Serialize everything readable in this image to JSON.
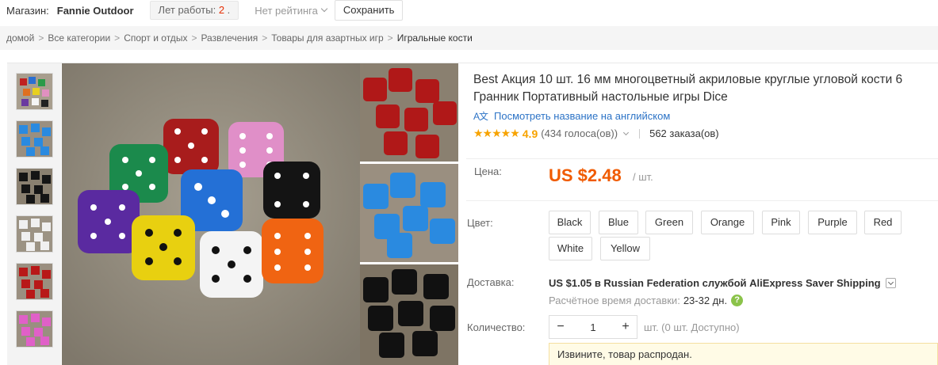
{
  "store": {
    "label": "Магазин:",
    "name": "Fannie Outdoor",
    "years_label": "Лет работы:",
    "years_value": "2",
    "rating": "Нет рейтинга",
    "save": "Сохранить"
  },
  "breadcrumb": [
    "домой",
    "Все категории",
    "Спорт и отдых",
    "Развлечения",
    "Товары для азартных игр",
    "Игральные кости"
  ],
  "breadcrumb_sep": ">",
  "product": {
    "title": "Best Акция 10 шт. 16 мм многоцветный акриловые круглые угловой кости 6 Гранник Портативный настольные игры Dice",
    "translate_icon": "A文",
    "translate_label": "Посмотреть название на английском",
    "stars": "★★★★★",
    "rating": "4.9",
    "votes": "(434 голоса(ов))",
    "orders": "562 заказа(ов)",
    "price_label": "Цена:",
    "price": "US $2.48",
    "price_unit": "/ шт.",
    "color_label": "Цвет:",
    "colors": [
      "Black",
      "Blue",
      "Green",
      "Orange",
      "Pink",
      "Purple",
      "Red",
      "White",
      "Yellow"
    ],
    "shipping_label": "Доставка:",
    "shipping": "US $1.05 в Russian Federation службой AliExpress Saver Shipping",
    "delivery_label": "Расчётное время доставки:",
    "delivery_days": "23-32 дн.",
    "help_icon": "?",
    "qty_label": "Количество:",
    "qty_minus": "−",
    "qty_value": "1",
    "qty_plus": "+",
    "qty_note": "шт. (0 шт. Доступно)",
    "soldout": "Извините, товар распродан."
  },
  "icons": {
    "translate": "translate-icon",
    "help": "question-circle-icon",
    "chevron": "chevron-down-icon"
  },
  "colors_theme": {
    "price": "#f05a00",
    "stars": "#f7a300",
    "link": "#2c73c6",
    "soldout_bg": "#fffbe6"
  }
}
